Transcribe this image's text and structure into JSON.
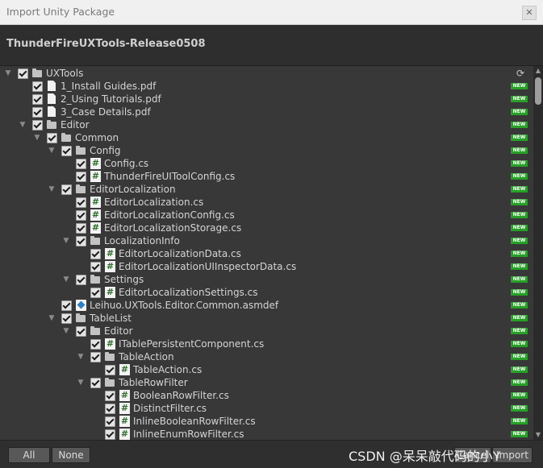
{
  "window": {
    "title": "Import Unity Package",
    "close_icon": "close-icon"
  },
  "package": {
    "name": "ThunderFireUXTools-Release0508"
  },
  "tree": {
    "badge_text": "NEW",
    "badge_color": "#27a027",
    "rows": [
      {
        "label": "UXTools",
        "type": "folder",
        "depth": 0,
        "expandable": true
      },
      {
        "label": "1_Install Guides.pdf",
        "type": "file",
        "depth": 1,
        "expandable": false
      },
      {
        "label": "2_Using Tutorials.pdf",
        "type": "file",
        "depth": 1,
        "expandable": false
      },
      {
        "label": "3_Case Details.pdf",
        "type": "file",
        "depth": 1,
        "expandable": false
      },
      {
        "label": "Editor",
        "type": "folder",
        "depth": 1,
        "expandable": true
      },
      {
        "label": "Common",
        "type": "folder",
        "depth": 2,
        "expandable": true
      },
      {
        "label": "Config",
        "type": "folder",
        "depth": 3,
        "expandable": true
      },
      {
        "label": "Config.cs",
        "type": "cs",
        "depth": 4,
        "expandable": false
      },
      {
        "label": "ThunderFireUIToolConfig.cs",
        "type": "cs",
        "depth": 4,
        "expandable": false
      },
      {
        "label": "EditorLocalization",
        "type": "folder",
        "depth": 3,
        "expandable": true
      },
      {
        "label": "EditorLocalization.cs",
        "type": "cs",
        "depth": 4,
        "expandable": false
      },
      {
        "label": "EditorLocalizationConfig.cs",
        "type": "cs",
        "depth": 4,
        "expandable": false
      },
      {
        "label": "EditorLocalizationStorage.cs",
        "type": "cs",
        "depth": 4,
        "expandable": false
      },
      {
        "label": "LocalizationInfo",
        "type": "folder",
        "depth": 4,
        "expandable": true
      },
      {
        "label": "EditorLocalizationData.cs",
        "type": "cs",
        "depth": 5,
        "expandable": false
      },
      {
        "label": "EditorLocalizationUIInspectorData.cs",
        "type": "cs",
        "depth": 5,
        "expandable": false
      },
      {
        "label": "Settings",
        "type": "folder",
        "depth": 4,
        "expandable": true
      },
      {
        "label": "EditorLocalizationSettings.cs",
        "type": "cs",
        "depth": 5,
        "expandable": false
      },
      {
        "label": "Leihuo.UXTools.Editor.Common.asmdef",
        "type": "asm",
        "depth": 3,
        "expandable": false
      },
      {
        "label": "TableList",
        "type": "folder",
        "depth": 3,
        "expandable": true
      },
      {
        "label": "Editor",
        "type": "folder",
        "depth": 4,
        "expandable": true
      },
      {
        "label": "ITablePersistentComponent.cs",
        "type": "cs",
        "depth": 5,
        "expandable": false
      },
      {
        "label": "TableAction",
        "type": "folder",
        "depth": 5,
        "expandable": true
      },
      {
        "label": "TableAction.cs",
        "type": "cs",
        "depth": 6,
        "expandable": false
      },
      {
        "label": "TableRowFilter",
        "type": "folder",
        "depth": 5,
        "expandable": true
      },
      {
        "label": "BooleanRowFilter.cs",
        "type": "cs",
        "depth": 6,
        "expandable": false
      },
      {
        "label": "DistinctFilter.cs",
        "type": "cs",
        "depth": 6,
        "expandable": false
      },
      {
        "label": "InlineBooleanRowFilter.cs",
        "type": "cs",
        "depth": 6,
        "expandable": false
      },
      {
        "label": "InlineEnumRowFilter.cs",
        "type": "cs",
        "depth": 6,
        "expandable": false
      }
    ]
  },
  "footer": {
    "all_label": "All",
    "none_label": "None",
    "cancel_label": "Cancel",
    "import_label": "Import",
    "watermark": "CSDN @呆呆敲代码的小Y"
  }
}
